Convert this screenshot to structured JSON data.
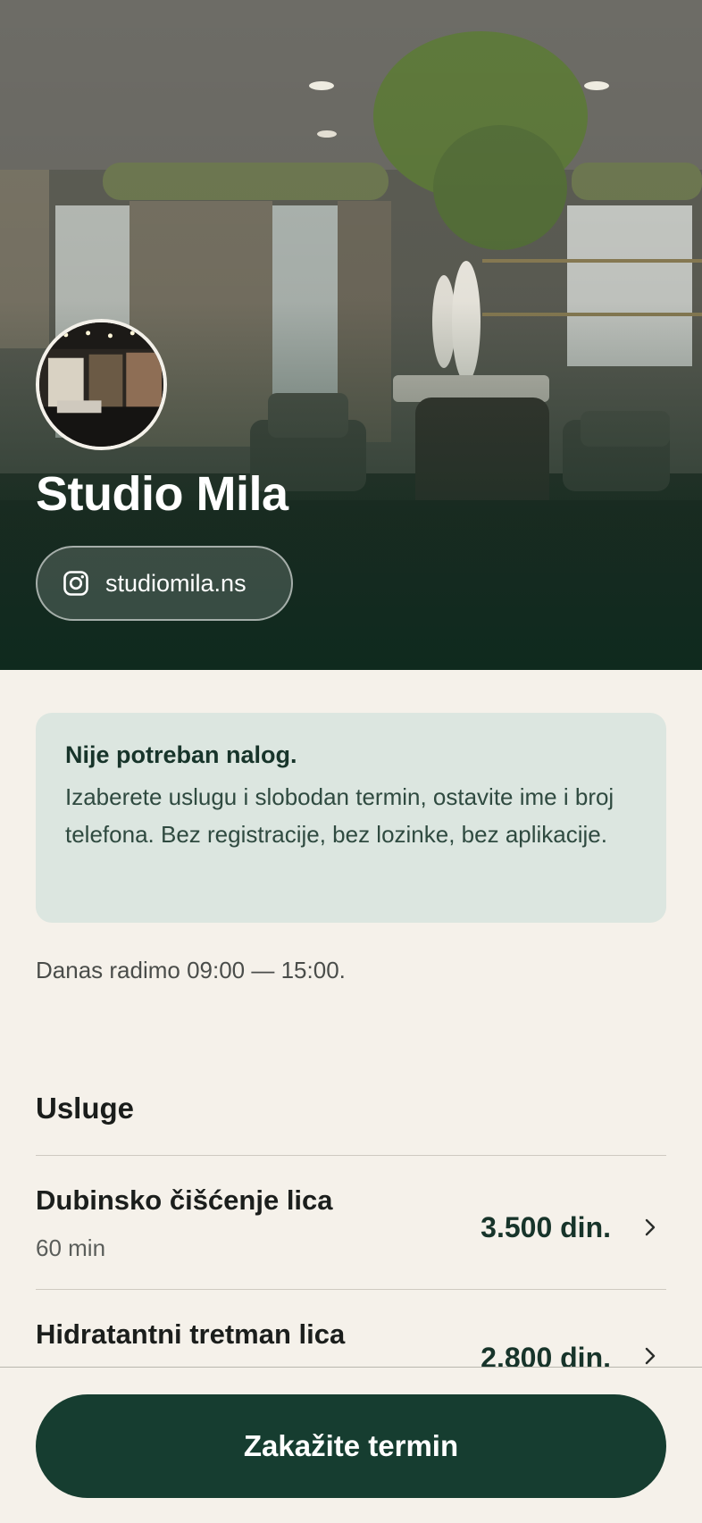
{
  "business": {
    "name": "Studio Mila",
    "instagram_handle": "studiomila.ns"
  },
  "notice": {
    "title": "Nije potreban nalog.",
    "body": "Izaberete uslugu i slobodan termin, ostavite ime i broj telefona. Bez registracije, bez lozinke, bez aplikacije."
  },
  "hours_text": "Danas radimo 09:00 — 15:00.",
  "services_section": {
    "title": "Usluge",
    "items": [
      {
        "name": "Dubinsko čišćenje lica",
        "duration": "60 min",
        "price": "3.500 din."
      },
      {
        "name": "Hidratantni tretman lica",
        "duration": "",
        "price": "2.800 din."
      }
    ]
  },
  "cta_label": "Zakažite termin",
  "colors": {
    "brand_dark_green": "#163d30",
    "notice_bg": "#dce6e0",
    "page_bg": "#f5f1ea"
  },
  "icons": [
    "instagram-icon",
    "chevron-right-icon"
  ]
}
